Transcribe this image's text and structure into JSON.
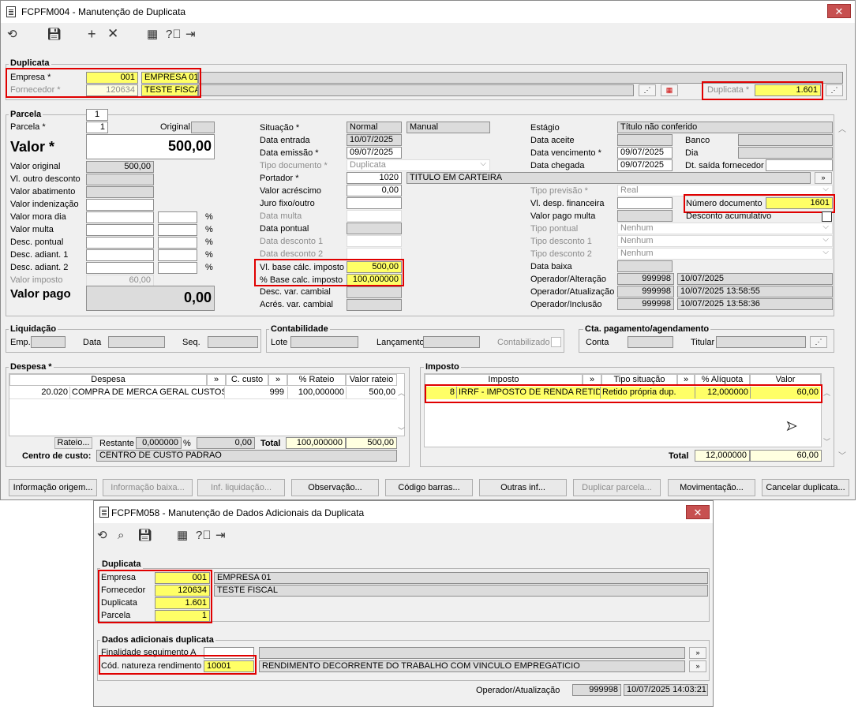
{
  "win1": {
    "title": "FCPFM004 - Manutenção de Duplicata",
    "close": "✕",
    "duplicata_section": "Duplicata",
    "empresa_label": "Empresa *",
    "empresa_code": "001",
    "empresa_name": "EMPRESA 01",
    "fornecedor_label": "Fornecedor *",
    "fornecedor_code": "120634",
    "fornecedor_name": "TESTE FISCAL",
    "duplicata_label": "Duplicata *",
    "duplicata_value": "1.601",
    "parcela_tab": "Parcela",
    "parcela_tab_num": "1",
    "parcela_label": "Parcela *",
    "parcela_value": "1",
    "original_label": "Original",
    "valor_label": "Valor *",
    "valor_value": "500,00",
    "valor_original_label": "Valor original",
    "valor_original_value": "500,00",
    "vl_outro_desconto_label": "Vl. outro desconto",
    "valor_abatimento_label": "Valor abatimento",
    "valor_indenizacao_label": "Valor indenização",
    "valor_mora_dia_label": "Valor mora dia",
    "valor_multa_label": "Valor multa",
    "desc_pontual_label": "Desc. pontual",
    "desc_adiant1_label": "Desc. adiant. 1",
    "desc_adiant2_label": "Desc. adiant. 2",
    "pct": "%",
    "valor_imposto_label": "Valor imposto",
    "valor_imposto_value": "60,00",
    "valor_pago_label": "Valor pago",
    "valor_pago_value": "0,00",
    "situacao_label": "Situação *",
    "situacao_value": "Normal",
    "situacao_value2": "Manual",
    "data_entrada_label": "Data entrada",
    "data_entrada_value": "10/07/2025",
    "data_emissao_label": "Data emissão *",
    "data_emissao_value": "09/07/2025",
    "tipo_documento_label": "Tipo documento *",
    "tipo_documento_value": "Duplicata",
    "portador_label": "Portador *",
    "portador_code": "1020",
    "portador_name": "TITULO EM CARTEIRA",
    "valor_acrescimo_label": "Valor acréscimo",
    "valor_acrescimo_value": "0,00",
    "juro_label": "Juro fixo/outro",
    "data_multa_label": "Data multa",
    "data_pontual_label": "Data pontual",
    "data_desconto1_label": "Data desconto 1",
    "data_desconto2_label": "Data desconto 2",
    "vl_base_label": "Vl. base cálc. imposto",
    "vl_base_value": "500,00",
    "pct_base_label": "% Base calc. imposto",
    "pct_base_value": "100,000000",
    "desc_var_label": "Desc. var. cambial",
    "acres_var_label": "Acrés. var. cambial",
    "estagio_label": "Estágio",
    "estagio_value": "Título não conferido",
    "data_aceite_label": "Data aceite",
    "banco_label": "Banco",
    "data_vencimento_label": "Data vencimento *",
    "data_vencimento_value": "09/07/2025",
    "dia_label": "Dia",
    "data_chegada_label": "Data chegada",
    "data_chegada_value": "09/07/2025",
    "dt_saida_label": "Dt. saída fornecedor",
    "tipo_previsao_label": "Tipo previsão *",
    "tipo_previsao_value": "Real",
    "vl_desp_fin_label": "Vl. desp. financeira",
    "numero_documento_label": "Número documento",
    "numero_documento_value": "1601",
    "valor_pago_multa_label": "Valor pago multa",
    "desconto_acumulativo_label": "Desconto acumulativo",
    "tipo_pontual_label": "Tipo pontual",
    "tipo_desconto1_label": "Tipo desconto 1",
    "tipo_desconto2_label": "Tipo desconto 2",
    "nenhum": "Nenhum",
    "data_baixa_label": "Data baixa",
    "op_alteracao_label": "Operador/Alteração",
    "op_alteracao_code": "999998",
    "op_alteracao_date": "10/07/2025",
    "op_atualizacao_label": "Operador/Atualização",
    "op_atualizacao_code": "999998",
    "op_atualizacao_date": "10/07/2025 13:58:55",
    "op_inclusao_label": "Operador/Inclusão",
    "op_inclusao_code": "999998",
    "op_inclusao_date": "10/07/2025 13:58:36",
    "liquidacao_title": "Liquidação",
    "emp_label": "Emp.",
    "data_label": "Data",
    "seq_label": "Seq.",
    "contabilidade_title": "Contabilidade",
    "lote_label": "Lote",
    "lancamento_label": "Lançamento",
    "contabilizado_label": "Contabilizado",
    "cta_title": "Cta. pagamento/agendamento",
    "conta_label": "Conta",
    "titular_label": "Titular",
    "despesa_title": "Despesa *",
    "despesa_cols": [
      "Despesa",
      "»",
      "C. custo",
      "»",
      "% Rateio",
      "Valor rateio"
    ],
    "despesa_row": [
      "20.020",
      "COMPRA DE MERCA GERAL CUSTOS M",
      "999",
      "100,000000",
      "500,00"
    ],
    "rateio_btn": "Rateio...",
    "restante_label": "Restante",
    "restante_value": "0,000000",
    "restante_value2": "0,00",
    "total_label": "Total",
    "total_rateio": "100,000000",
    "total_valor": "500,00",
    "centro_custo_label": "Centro de custo:",
    "centro_custo_value": "CENTRO DE CUSTO PADRAO",
    "imposto_title": "Imposto",
    "imposto_cols": [
      "Imposto",
      "»",
      "Tipo situação",
      "»",
      "% Alíquota",
      "Valor"
    ],
    "imposto_row": [
      "8",
      "IRRF - IMPOSTO DE RENDA RETIDO N",
      "Retido própria dup.",
      "12,000000",
      "60,00"
    ],
    "imposto_total_label": "Total",
    "imposto_total_aliquota": "12,000000",
    "imposto_total_valor": "60,00",
    "buttons": [
      "Informação origem...",
      "Informação baixa...",
      "Inf. liquidação...",
      "Observação...",
      "Código barras...",
      "Outras inf...",
      "Duplicar parcela...",
      "Movimentação...",
      "Cancelar duplicata..."
    ]
  },
  "win2": {
    "title": "FCPFM058 - Manutenção de Dados Adicionais da Duplicata",
    "close": "✕",
    "duplicata_title": "Duplicata",
    "empresa_label": "Empresa",
    "empresa_code": "001",
    "empresa_name": "EMPRESA 01",
    "fornecedor_label": "Fornecedor",
    "fornecedor_code": "120634",
    "fornecedor_name": "TESTE FISCAL",
    "duplicata_label": "Duplicata",
    "duplicata_value": "1.601",
    "parcela_label": "Parcela",
    "parcela_value": "1",
    "dados_title": "Dados adicionais duplicata",
    "finalidade_label": "Finalidade seguimento A",
    "cod_natureza_label": "Cód. natureza rendimento",
    "cod_natureza_value": "10001",
    "cod_natureza_desc": "RENDIMENTO DECORRENTE DO TRABALHO COM VINCULO EMPREGATICIO",
    "operador_label": "Operador/Atualização",
    "operador_code": "999998",
    "operador_date": "10/07/2025 14:03:21"
  }
}
